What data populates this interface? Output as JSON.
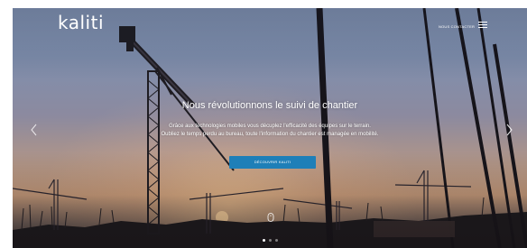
{
  "brand": {
    "logo_text": "kaliti"
  },
  "header": {
    "nav_link_label": "NOUS CONTACTER"
  },
  "hero": {
    "headline": "Nous révolutionnons le suivi de chantier",
    "subline_1": "Grâce aux technologies mobiles vous décuplez l'efficacité des équipes sur le terrain.",
    "subline_2": "Oubliez le temps perdu au bureau, toute l'information du chantier est managée en mobilité.",
    "cta_label": "DÉCOUVRIR KALITI"
  },
  "carousel": {
    "slide_count": 3,
    "active_slide": 1
  },
  "icons": {
    "menu": "hamburger-icon",
    "prev": "chevron-left-icon",
    "next": "chevron-right-icon",
    "scroll": "mouse-scroll-icon"
  },
  "colors": {
    "cta_background": "#1e7fb8",
    "text": "#ffffff"
  }
}
